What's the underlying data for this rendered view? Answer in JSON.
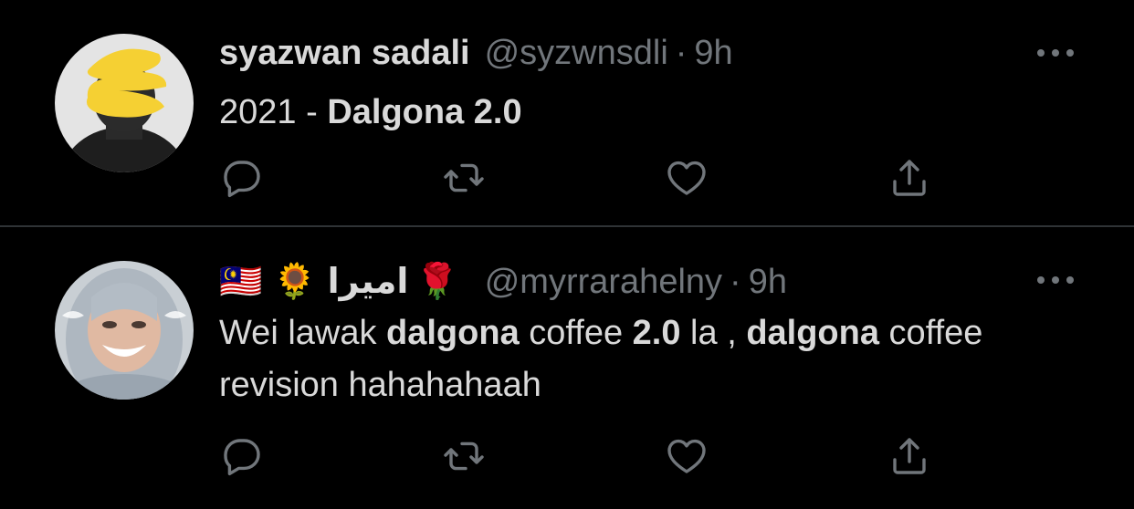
{
  "colors": {
    "background": "#000000",
    "text": "#d9d9d9",
    "muted": "#71767b",
    "divider": "#2f3336"
  },
  "tweets": [
    {
      "display_name": "syazwan sadali",
      "handle": "@syzwnsdli",
      "separator": "·",
      "time": "9h",
      "body": {
        "plain_1": "2021 - ",
        "bold_1": "Dalgona 2.0"
      },
      "icons": [
        "reply-icon",
        "retweet-icon",
        "like-icon",
        "share-icon",
        "more-icon"
      ]
    },
    {
      "display_name_emoji_1": "🇲🇾",
      "display_name_emoji_2": "🌻",
      "display_name_text": "اميرا",
      "display_name_emoji_3": "🌹",
      "handle": "@myrrarahelny",
      "separator": "·",
      "time": "9h",
      "body": {
        "plain_1": "Wei lawak ",
        "bold_1": "dalgona",
        "plain_2": " coffee ",
        "bold_2": "2.0",
        "plain_3": " la , ",
        "bold_3": "dalgona",
        "plain_4": " coffee revision hahahahaah"
      },
      "icons": [
        "reply-icon",
        "retweet-icon",
        "like-icon",
        "share-icon",
        "more-icon"
      ]
    }
  ]
}
